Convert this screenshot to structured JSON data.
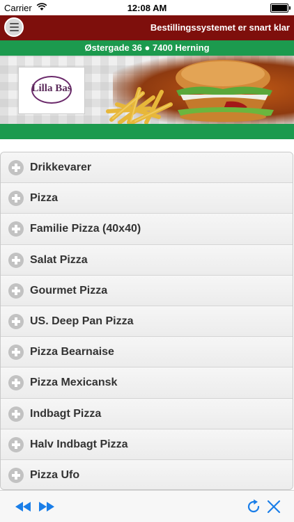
{
  "status_bar": {
    "carrier": "Carrier",
    "time": "12:08 AM",
    "wifi_icon": "wifi-icon",
    "battery_icon": "battery-icon"
  },
  "header": {
    "menu_icon": "hamburger-menu-icon",
    "title": "Bestillingssystemet er snart klar",
    "background_color": "#7e0f0c"
  },
  "address": {
    "text": "Østergade 36 ● 7400 Herning",
    "background_color": "#1c9a4e"
  },
  "banner": {
    "logo_text": "Lilla Bas",
    "images": [
      "fries-image",
      "burger-image"
    ]
  },
  "categories": [
    {
      "label": "Drikkevarer",
      "icon": "plus-circle-icon"
    },
    {
      "label": "Pizza",
      "icon": "plus-circle-icon"
    },
    {
      "label": "Familie Pizza (40x40)",
      "icon": "plus-circle-icon"
    },
    {
      "label": "Salat Pizza",
      "icon": "plus-circle-icon"
    },
    {
      "label": "Gourmet Pizza",
      "icon": "plus-circle-icon"
    },
    {
      "label": "US. Deep Pan Pizza",
      "icon": "plus-circle-icon"
    },
    {
      "label": "Pizza Bearnaise",
      "icon": "plus-circle-icon"
    },
    {
      "label": "Pizza Mexicansk",
      "icon": "plus-circle-icon"
    },
    {
      "label": "Indbagt Pizza",
      "icon": "plus-circle-icon"
    },
    {
      "label": "Halv Indbagt Pizza",
      "icon": "plus-circle-icon"
    },
    {
      "label": "Pizza Ufo",
      "icon": "plus-circle-icon"
    }
  ],
  "toolbar": {
    "back_icon": "rewind-icon",
    "forward_icon": "fast-forward-icon",
    "reload_icon": "reload-icon",
    "close_icon": "close-icon",
    "accent_color": "#1a7ee8"
  }
}
